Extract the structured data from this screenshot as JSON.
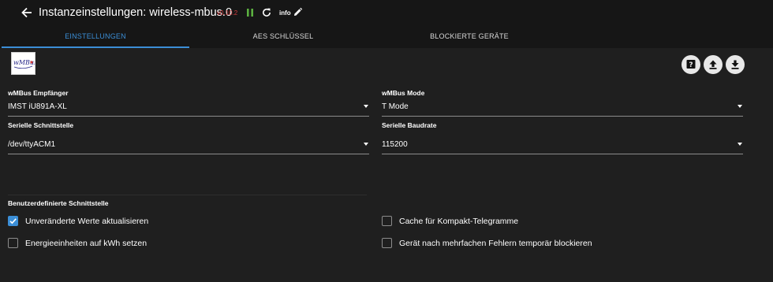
{
  "header": {
    "title": "Instanzeinstellungen: wireless-mbus.0",
    "version": "v0.10.2",
    "info_label": "info"
  },
  "tabs": [
    {
      "label": "EINSTELLUNGEN",
      "active": true
    },
    {
      "label": "AES SCHLÜSSEL",
      "active": false
    },
    {
      "label": "BLOCKIERTE GERÄTE",
      "active": false
    }
  ],
  "logo": {
    "text": "wMBus",
    "icon": "wmbus-logo"
  },
  "actions": [
    {
      "icon": "help-icon"
    },
    {
      "icon": "upload-icon"
    },
    {
      "icon": "download-icon"
    }
  ],
  "form": {
    "receiver": {
      "label": "wMBus Empfänger",
      "value": "IMST iU891A-XL"
    },
    "mode": {
      "label": "wMBus Mode",
      "value": "T Mode"
    },
    "serial_port": {
      "label": "Serielle Schnittstelle",
      "value": "/dev/ttyACM1"
    },
    "baudrate": {
      "label": "Serielle Baudrate",
      "value": "115200"
    },
    "custom_port_label": "Benutzerdefinierte Schnittstelle"
  },
  "checkboxes": [
    {
      "label": "Unveränderte Werte aktualisieren",
      "checked": true
    },
    {
      "label": "Energieeinheiten auf kWh setzen",
      "checked": false
    },
    {
      "label": "Cache für Kompakt-Telegramme",
      "checked": false
    },
    {
      "label": "Gerät nach mehrfachen Fehlern temporär blockieren",
      "checked": false
    }
  ],
  "colors": {
    "accent": "#3b8ed6",
    "version": "#d23c3c",
    "pause": "#5bb040",
    "background": "#1f1f1f",
    "header": "#161616"
  }
}
